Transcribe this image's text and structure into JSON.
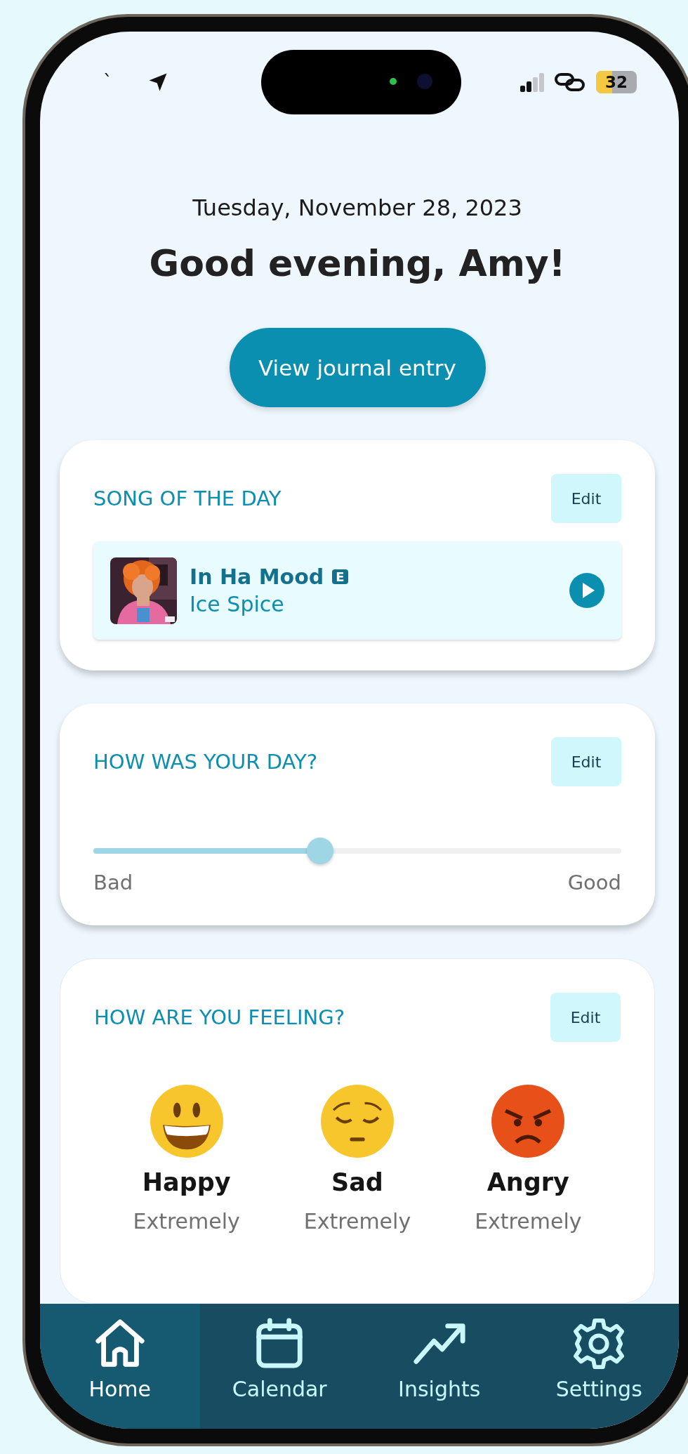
{
  "status_bar": {
    "left_text": "`",
    "battery": "32"
  },
  "date": "Tuesday, November 28, 2023",
  "greeting": "Good evening, Amy!",
  "journal_button": "View journal entry",
  "song_card": {
    "title": "SONG OF THE DAY",
    "edit": "Edit",
    "song": {
      "title": "In Ha Mood",
      "explicit_badge": "E",
      "artist": "Ice Spice"
    }
  },
  "day_card": {
    "title": "HOW WAS YOUR DAY?",
    "edit": "Edit",
    "slider": {
      "level": 0.43
    },
    "min_label": "Bad",
    "max_label": "Good"
  },
  "feeling_card": {
    "title": "HOW ARE YOU FEELING?",
    "edit": "Edit",
    "feelings": [
      {
        "kind": "happy",
        "name": "Happy",
        "intensity": "Extremely"
      },
      {
        "kind": "sad",
        "name": "Sad",
        "intensity": "Extremely"
      },
      {
        "kind": "angry",
        "name": "Angry",
        "intensity": "Extremely"
      }
    ]
  },
  "nav": [
    {
      "kind": "home",
      "label": "Home",
      "selected": true
    },
    {
      "kind": "calendar",
      "label": "Calendar",
      "selected": false
    },
    {
      "kind": "insights",
      "label": "Insights",
      "selected": false
    },
    {
      "kind": "settings",
      "label": "Settings",
      "selected": false
    }
  ]
}
